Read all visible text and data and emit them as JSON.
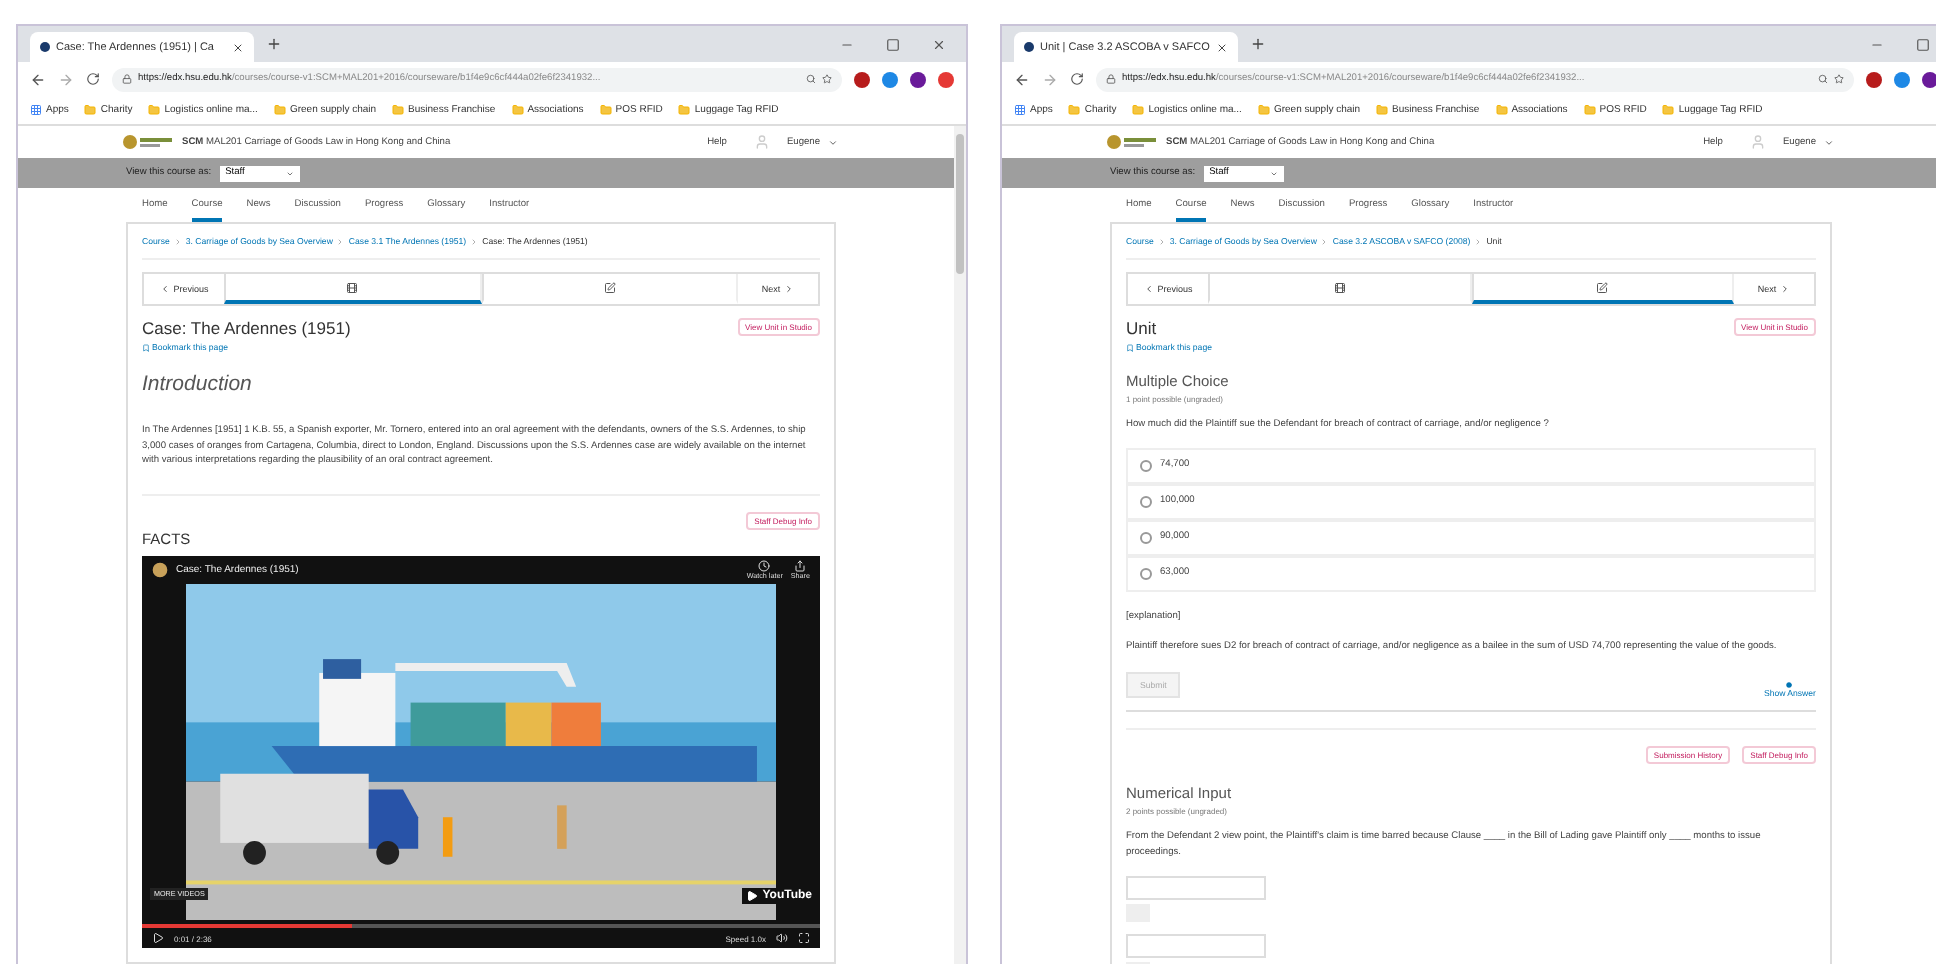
{
  "windows": [
    {
      "tab": {
        "title": "Case: The Ardennes (1951) | Ca"
      },
      "controls": [
        {
          "kind": "minimize"
        },
        {
          "kind": "maximize"
        },
        {
          "kind": "close"
        }
      ],
      "url": {
        "host": "https://edx.hsu.edu.hk",
        "path": "/courses/course-v1:SCM+MAL201+2016/courseware/b1f4e9c6cf444a02fe6f2341932..."
      },
      "extensions": [
        {
          "color": "#b71c1c"
        },
        {
          "color": "#1e88e5"
        },
        {
          "color": "#6a1b9a"
        },
        {
          "color": "#e53935"
        }
      ],
      "bookmarks": [
        {
          "kind": "apps",
          "label": "Apps"
        },
        {
          "kind": "folder",
          "label": "Charity"
        },
        {
          "kind": "folder",
          "label": "Logistics online ma..."
        },
        {
          "kind": "folder",
          "label": "Green supply chain"
        },
        {
          "kind": "folder",
          "label": "Business Franchise"
        },
        {
          "kind": "folder",
          "label": "Associations"
        },
        {
          "kind": "folder",
          "label": "POS RFID"
        },
        {
          "kind": "folder",
          "label": "Luggage Tag RFID"
        }
      ],
      "site": {
        "course": "**SCM** MAL201 Carriage of Goods Law in Hong Kong and China",
        "help": "Help",
        "user": "Eugene",
        "view_as_label": "View this course as:",
        "view_as": "Staff"
      },
      "nav": [
        {
          "label": "Home",
          "selected": false
        },
        {
          "label": "Course",
          "selected": true
        },
        {
          "label": "News",
          "selected": false
        },
        {
          "label": "Discussion",
          "selected": false
        },
        {
          "label": "Progress",
          "selected": false
        },
        {
          "label": "Glossary",
          "selected": false
        },
        {
          "label": "Instructor",
          "selected": false
        }
      ],
      "breadcrumb": [
        "Course",
        "3. Carriage of Goods by Sea Overview",
        "Case 3.1 The Ardennes (1951)",
        "Case: The Ardennes (1951)"
      ],
      "sequence": {
        "previous": "Previous",
        "next": "Next",
        "units": [
          {
            "kind": "video",
            "selected": true
          },
          {
            "kind": "problem",
            "selected": false
          }
        ]
      },
      "scrollbar": true,
      "content": [
        {
          "kind": "unit_title",
          "text": "Case: The Ardennes (1951)",
          "bookmark": "Bookmark this page",
          "studio": "View Unit in Studio"
        },
        {
          "kind": "section_heading",
          "text": "Introduction"
        },
        {
          "kind": "paragraph",
          "text": "In The Ardennes [1951] 1 K.B. 55, a Spanish exporter, Mr. Tornero, entered into an oral agreement with the defendants, owners of the S.S. Ardennes, to ship 3,000 cases of oranges from Cartagena, Columbia, direct to London, England. Discussions upon the S.S. Ardennes case are widely available on the internet with various interpretations regarding the plausibility of an oral contract agreement."
        },
        {
          "kind": "chips",
          "items": [
            "Staff Debug Info"
          ]
        },
        {
          "kind": "heading",
          "text": "FACTS"
        },
        {
          "kind": "video",
          "title": "Case: The Ardennes (1951)",
          "watch_later": "Watch later",
          "share": "Share",
          "more_videos": "MORE VIDEOS",
          "logo": "YouTube",
          "time": "0:01 / 2:36",
          "speed": "Speed 1.0x",
          "level": 0.31
        }
      ]
    },
    {
      "tab": {
        "title": "Unit | Case 3.2 ASCOBA v SAFCO"
      },
      "controls": [
        {
          "kind": "minimize"
        },
        {
          "kind": "maximize"
        }
      ],
      "url": {
        "host": "https://edx.hsu.edu.hk",
        "path": "/courses/course-v1:SCM+MAL201+2016/courseware/b1f4e9c6cf444a02fe6f2341932..."
      },
      "extensions": [
        {
          "color": "#b71c1c"
        },
        {
          "color": "#1e88e5"
        },
        {
          "color": "#6a1b9a"
        }
      ],
      "bookmarks": [
        {
          "kind": "apps",
          "label": "Apps"
        },
        {
          "kind": "folder",
          "label": "Charity"
        },
        {
          "kind": "folder",
          "label": "Logistics online ma..."
        },
        {
          "kind": "folder",
          "label": "Green supply chain"
        },
        {
          "kind": "folder",
          "label": "Business Franchise"
        },
        {
          "kind": "folder",
          "label": "Associations"
        },
        {
          "kind": "folder",
          "label": "POS RFID"
        },
        {
          "kind": "folder",
          "label": "Luggage Tag RFID"
        }
      ],
      "site": {
        "course": "**SCM** MAL201 Carriage of Goods Law in Hong Kong and China",
        "help": "Help",
        "user": "Eugene",
        "view_as_label": "View this course as:",
        "view_as": "Staff"
      },
      "nav": [
        {
          "label": "Home",
          "selected": false
        },
        {
          "label": "Course",
          "selected": true
        },
        {
          "label": "News",
          "selected": false
        },
        {
          "label": "Discussion",
          "selected": false
        },
        {
          "label": "Progress",
          "selected": false
        },
        {
          "label": "Glossary",
          "selected": false
        },
        {
          "label": "Instructor",
          "selected": false
        }
      ],
      "breadcrumb": [
        "Course",
        "3. Carriage of Goods by Sea Overview",
        "Case 3.2 ASCOBA v SAFCO (2008)",
        "Unit"
      ],
      "sequence": {
        "previous": "Previous",
        "next": "Next",
        "units": [
          {
            "kind": "video",
            "selected": false
          },
          {
            "kind": "problem",
            "selected": true
          }
        ]
      },
      "content": [
        {
          "kind": "unit_title",
          "text": "Unit",
          "bookmark": "Bookmark this page",
          "studio": "View Unit in Studio"
        },
        {
          "kind": "problem_title",
          "text": "Multiple Choice"
        },
        {
          "kind": "note",
          "text": "1 point possible (ungraded)"
        },
        {
          "kind": "paragraph",
          "text": "How much did the Plaintiff sue the Defendant for breach of contract of carriage, and/or negligence ?"
        },
        {
          "kind": "choices",
          "options": [
            {
              "label": "74,700",
              "selected": false
            },
            {
              "label": "100,000",
              "selected": false
            },
            {
              "label": "90,000",
              "selected": false
            },
            {
              "label": "63,000",
              "selected": false
            }
          ]
        },
        {
          "kind": "paragraph",
          "text": "[explanation]"
        },
        {
          "kind": "paragraph",
          "text": "Plaintiff therefore sues D2 for breach of contract of carriage, and/or negligence as a bailee in the sum of USD 74,700 representing the value of the goods."
        },
        {
          "kind": "actions",
          "submit": {
            "label": "Submit",
            "disabled": true
          },
          "show_answer": "Show Answer"
        },
        {
          "kind": "chips",
          "items": [
            "Submission History",
            "Staff Debug Info"
          ]
        },
        {
          "kind": "problem_title",
          "text": "Numerical Input"
        },
        {
          "kind": "note",
          "text": "2 points possible (ungraded)"
        },
        {
          "kind": "paragraph",
          "text": "From the Defendant 2 view point, the Plaintiff's claim is time barred because Clause ____ in the Bill of Lading gave Plaintiff only ____ months to issue proceedings."
        },
        {
          "kind": "answer_field"
        },
        {
          "kind": "answer_field"
        }
      ]
    }
  ]
}
